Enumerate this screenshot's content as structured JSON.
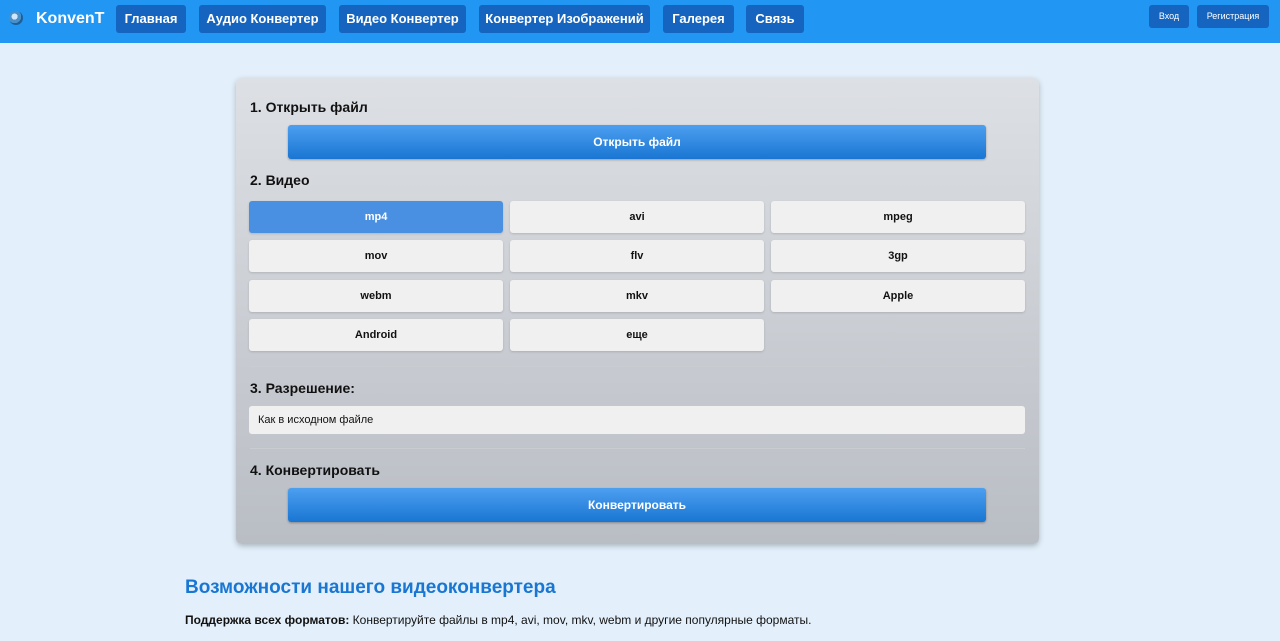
{
  "header": {
    "logo_icon": "globe-logo-icon",
    "brand": "KonvenT",
    "nav": [
      {
        "label": "Главная"
      },
      {
        "label": "Аудио Конвертер"
      },
      {
        "label": "Видео Конвертер"
      },
      {
        "label": "Конвертер Изображений"
      },
      {
        "label": "Галерея"
      },
      {
        "label": "Связь"
      }
    ],
    "login_label": "Вход",
    "register_label": "Регистрация"
  },
  "converter": {
    "step1_title": "1. Открыть файл",
    "open_file_label": "Открыть файл",
    "step2_title": "2. Видео",
    "formats": [
      "mp4",
      "avi",
      "mpeg",
      "mov",
      "flv",
      "3gp",
      "webm",
      "mkv",
      "Apple",
      "Android",
      "еще"
    ],
    "selected_format": "mp4",
    "step3_title": "3. Разрешение:",
    "resolution_value": "Как в исходном файле",
    "step4_title": "4. Конвертировать",
    "convert_label": "Конвертировать"
  },
  "features": {
    "title": "Возможности нашего видеоконвертера",
    "item1_label": "Поддержка всех форматов:",
    "item1_text": " Конвертируйте файлы в mp4, avi, mov, mkv, webm и другие популярные форматы."
  },
  "colors": {
    "header_bg": "#2196f3",
    "nav_bg": "#1565c0",
    "active_format": "#4a90e2",
    "accent_text": "#1976d2",
    "page_bg": "#e3f0fb"
  }
}
